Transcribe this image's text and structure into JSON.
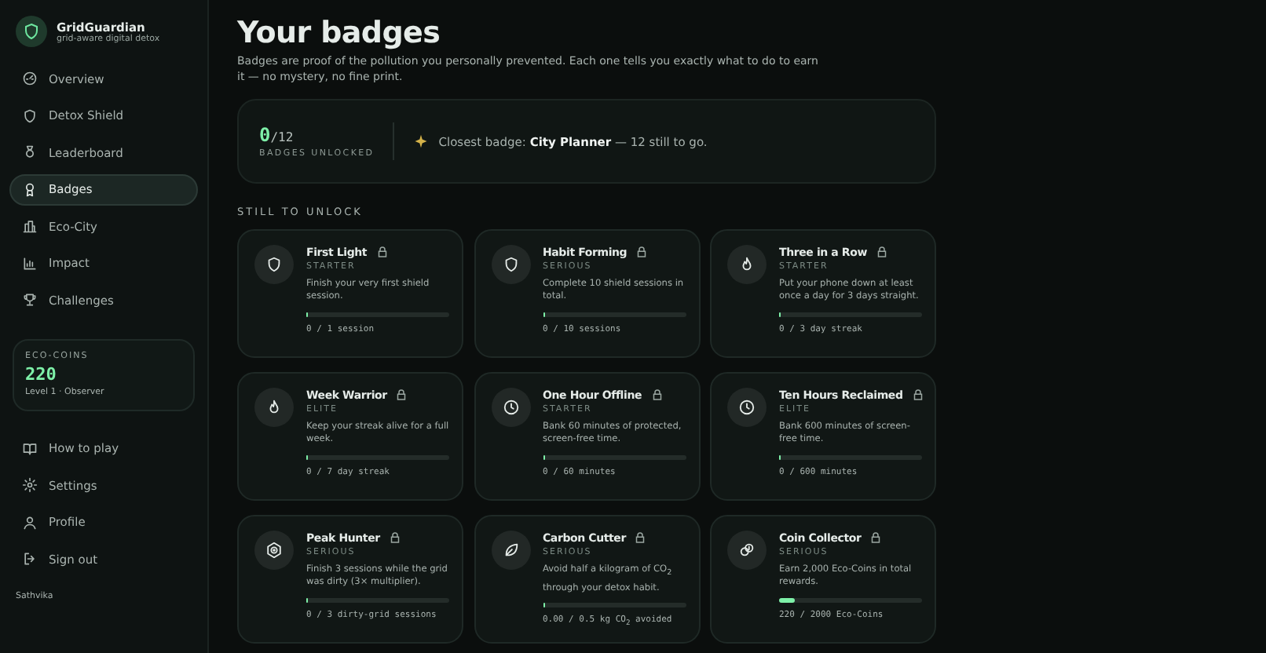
{
  "brand": {
    "name": "GridGuardian",
    "tagline": "grid-aware digital detox"
  },
  "nav": [
    {
      "label": "Overview",
      "selected": false
    },
    {
      "label": "Detox Shield",
      "selected": false
    },
    {
      "label": "Leaderboard",
      "selected": false
    },
    {
      "label": "Badges",
      "selected": true
    },
    {
      "label": "Eco-City",
      "selected": false
    },
    {
      "label": "Impact",
      "selected": false
    },
    {
      "label": "Challenges",
      "selected": false
    }
  ],
  "coins": {
    "label": "ECO-COINS",
    "value": "220",
    "level": "Level 1 · Observer"
  },
  "footer_nav": [
    {
      "label": "How to play"
    },
    {
      "label": "Settings"
    },
    {
      "label": "Profile"
    },
    {
      "label": "Sign out"
    }
  ],
  "user": "Sathvika",
  "title": "Your badges",
  "subtitle": "Badges are proof of the pollution you personally prevented. Each one tells you exactly what to do to earn it — no mystery, no fine print.",
  "summary": {
    "count": "0",
    "total": "/12",
    "label": "BADGES UNLOCKED",
    "closest": "Closest badge: **City Planner** — 12 still to go."
  },
  "section": "STILL TO UNLOCK",
  "badges": [
    {
      "name": "First Light",
      "locked": true,
      "tier": "STARTER",
      "desc": "Finish your very first shield session.",
      "level": 0,
      "progress": "0 / 1 session"
    },
    {
      "name": "Habit Forming",
      "locked": true,
      "tier": "SERIOUS",
      "desc": "Complete 10 shield sessions in total.",
      "level": 0,
      "progress": "0 / 10 sessions"
    },
    {
      "name": "Three in a Row",
      "locked": true,
      "tier": "STARTER",
      "desc": "Put your phone down at least once a day for 3 days straight.",
      "level": 0,
      "progress": "0 / 3 day streak"
    },
    {
      "name": "Week Warrior",
      "locked": true,
      "tier": "ELITE",
      "desc": "Keep your streak alive for a full week.",
      "level": 0,
      "progress": "0 / 7 day streak"
    },
    {
      "name": "One Hour Offline",
      "locked": true,
      "tier": "STARTER",
      "desc": "Bank 60 minutes of protected, screen-free time.",
      "level": 0,
      "progress": "0 / 60 minutes"
    },
    {
      "name": "Ten Hours Reclaimed",
      "locked": true,
      "tier": "ELITE",
      "desc": "Bank 600 minutes of screen-free time.",
      "level": 0,
      "progress": "0 / 600 minutes"
    },
    {
      "name": "Peak Hunter",
      "locked": true,
      "tier": "SERIOUS",
      "desc": "Finish 3 sessions while the grid was dirty (3× multiplier).",
      "level": 0,
      "progress": "0 / 3 dirty-grid sessions"
    },
    {
      "name": "Carbon Cutter",
      "locked": true,
      "tier": "SERIOUS",
      "desc": "Avoid half a kilogram of CO$_{2}$ through your detox habit.",
      "level": 0,
      "progress": "0.00 / 0.5 kg CO$_{2}$ avoided"
    },
    {
      "name": "Coin Collector",
      "locked": true,
      "tier": "SERIOUS",
      "desc": "Earn 2,000 Eco-Coins in total rewards.",
      "level": 0.11,
      "progress": "220 / 2000 Eco-Coins"
    }
  ]
}
